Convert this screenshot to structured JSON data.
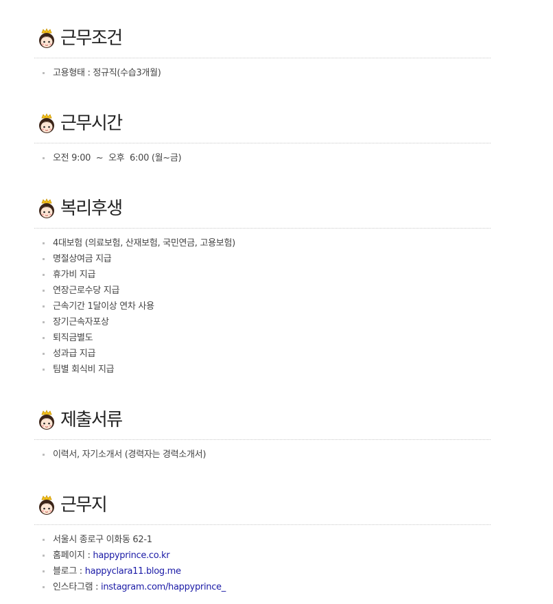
{
  "sections": [
    {
      "title": "근무조건",
      "items": [
        {
          "text": "고용형태 : 정규직(수습3개월)"
        }
      ]
    },
    {
      "title": "근무시간",
      "items": [
        {
          "text": "오전 9:00  ~  오후  6:00 (월~금)"
        }
      ]
    },
    {
      "title": "복리후생",
      "items": [
        {
          "text": "4대보험 (의료보험, 산재보험, 국민연금, 고용보험)"
        },
        {
          "text": "명절상여금 지급"
        },
        {
          "text": "휴가비 지급"
        },
        {
          "text": "연장근로수당 지급"
        },
        {
          "text": "근속기간 1달이상 연차 사용"
        },
        {
          "text": "장기근속자포상"
        },
        {
          "text": "퇴직금별도"
        },
        {
          "text": "성과급 지급"
        },
        {
          "text": "팀별 회식비 지급"
        }
      ]
    },
    {
      "title": "제출서류",
      "items": [
        {
          "text": "이력서, 자기소개서 (경력자는 경력소개서)"
        }
      ]
    },
    {
      "title": "근무지",
      "items": [
        {
          "text": "서울시 종로구 이화동 62-1"
        },
        {
          "label": "홈페이지 : ",
          "link": "happyprince.co.kr"
        },
        {
          "label": "블로그 : ",
          "link": "happyclara11.blog.me"
        },
        {
          "label": "인스타그램 : ",
          "link": "instagram.com/happyprince_"
        }
      ]
    }
  ],
  "icon": "prince-face-icon",
  "colors": {
    "link": "#1a1aa6",
    "title": "#222222",
    "text": "#444444",
    "rule": "#c8c8c8"
  }
}
